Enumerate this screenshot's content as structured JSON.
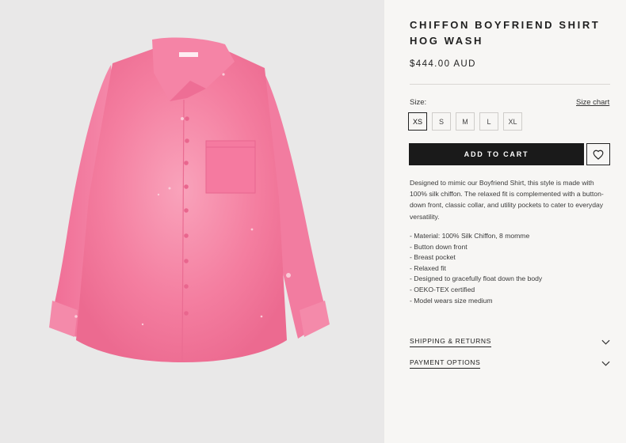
{
  "product": {
    "title": "CHIFFON BOYFRIEND SHIRT HOG WASH",
    "price": "$444.00 AUD",
    "image": {
      "alt_icon": "pink-chiffon-shirt-image",
      "color": "#f47ea0"
    }
  },
  "size_selector": {
    "label": "Size:",
    "size_chart_label": "Size chart",
    "options": [
      "XS",
      "S",
      "M",
      "L",
      "XL"
    ],
    "selected": "XS"
  },
  "actions": {
    "add_to_cart_label": "ADD TO CART",
    "wishlist_icon": "heart-icon"
  },
  "description": {
    "text": "Designed to mimic our Boyfriend Shirt, this style is made with 100% silk chiffon. The relaxed fit is complemented with a button-down front, classic collar, and utility pockets to cater to everyday versatility.",
    "features": [
      "- Material: 100% Silk Chiffon, 8 momme",
      "- Button down front",
      "- Breast pocket",
      "- Relaxed fit",
      "- Designed to gracefully float down the body",
      "- OEKO-TEX certified",
      "- Model wears size medium"
    ]
  },
  "accordions": [
    {
      "label": "SHIPPING & RETURNS",
      "icon": "chevron-down-icon"
    },
    {
      "label": "PAYMENT OPTIONS",
      "icon": "chevron-down-icon"
    }
  ],
  "colors": {
    "accent": "#1a1a1a",
    "panel_bg": "#f7f6f4",
    "image_bg": "#e9e8e8",
    "shirt_pink": "#f47ea0"
  }
}
